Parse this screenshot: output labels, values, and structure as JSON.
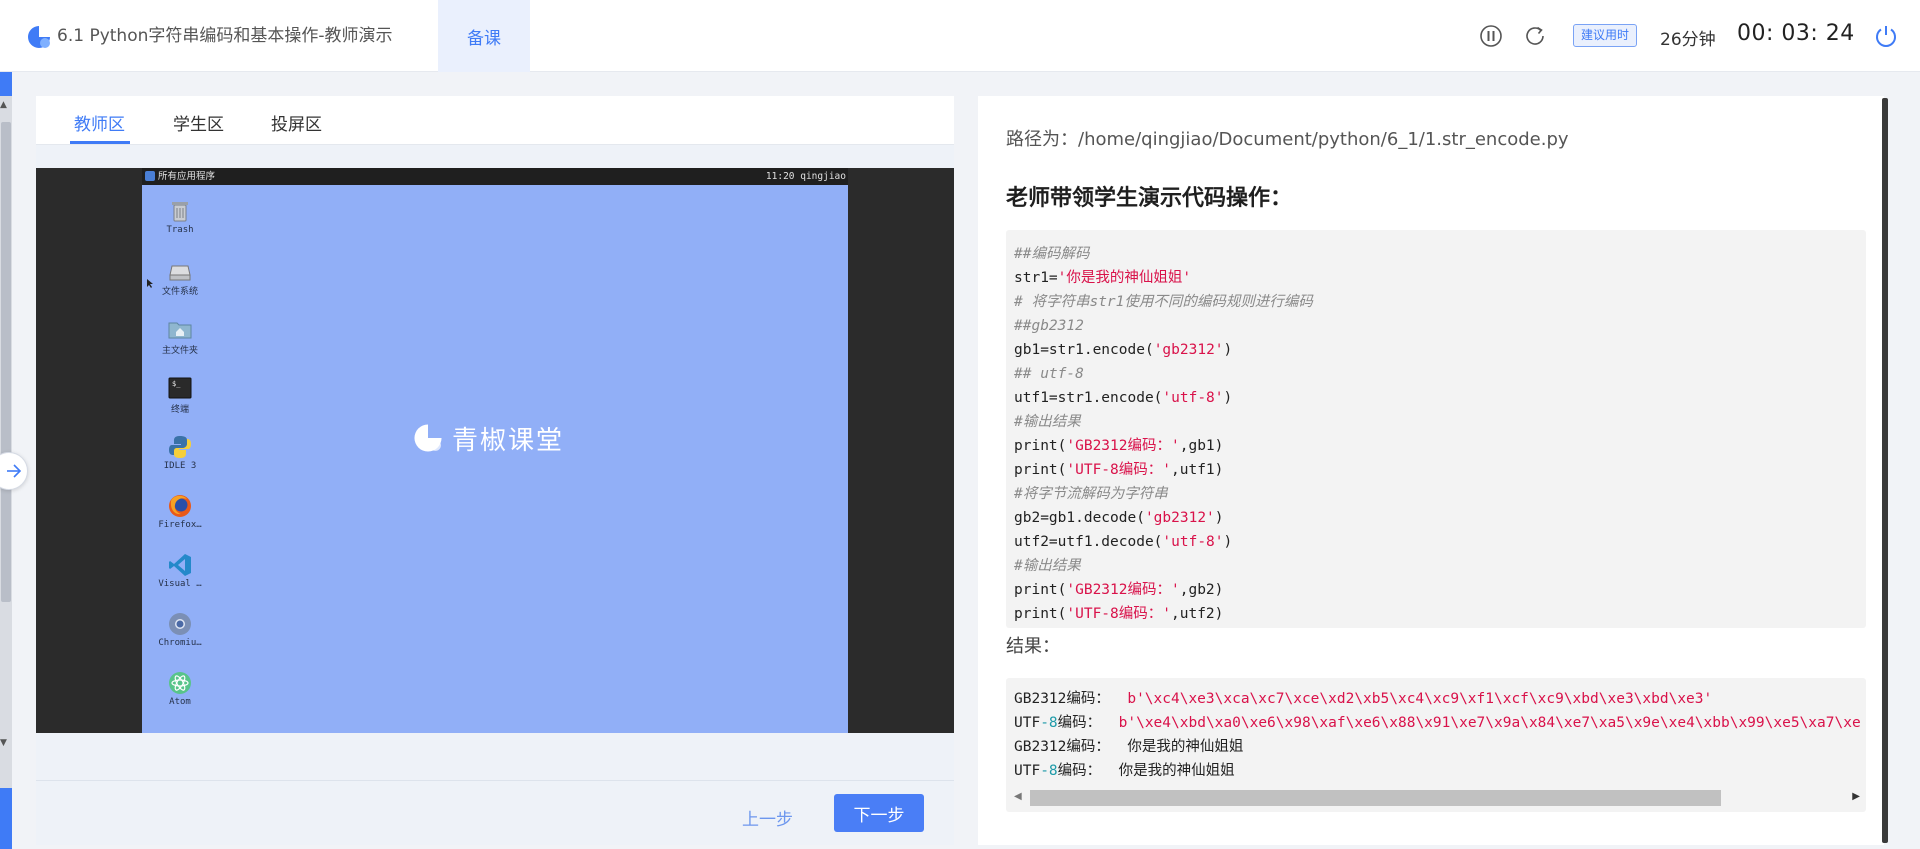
{
  "header": {
    "title": "6.1 Python字符串编码和基本操作-教师演示",
    "tab_label": "备课",
    "suggest_label": "建议用时",
    "duration": "26分钟",
    "timer": "00: 03: 24"
  },
  "left": {
    "tabs": [
      "教师区",
      "学生区",
      "投屏区"
    ],
    "active_tab": 0,
    "vm": {
      "menu_label": "所有应用程序",
      "clock": "11:20 qingjiao",
      "brand": "青椒课堂",
      "icons": [
        {
          "label": "Trash",
          "icon": "trash-icon"
        },
        {
          "label": "文件系统",
          "icon": "drive-icon"
        },
        {
          "label": "主文件夹",
          "icon": "home-folder-icon"
        },
        {
          "label": "终端",
          "icon": "terminal-icon"
        },
        {
          "label": "IDLE 3",
          "icon": "python-icon"
        },
        {
          "label": "Firefox…",
          "icon": "firefox-icon"
        },
        {
          "label": "Visual …",
          "icon": "vscode-icon"
        },
        {
          "label": "Chromiu…",
          "icon": "chromium-icon"
        },
        {
          "label": "Atom",
          "icon": "atom-icon"
        }
      ]
    },
    "prev_label": "上一步",
    "next_label": "下一步"
  },
  "right": {
    "path": "路径为：/home/qingjiao/Document/python/6_1/1.str_encode.py",
    "heading": "老师带领学生演示代码操作：",
    "code_lines": [
      [
        {
          "t": "##编码解码",
          "c": "cm"
        }
      ],
      [
        {
          "t": "str1=",
          "c": ""
        },
        {
          "t": "'你是我的神仙姐姐'",
          "c": "st"
        }
      ],
      [
        {
          "t": "# 将字符串str1使用不同的编码规则进行编码",
          "c": "cm"
        }
      ],
      [
        {
          "t": "##gb2312",
          "c": "cm"
        }
      ],
      [
        {
          "t": "gb1=str1.encode(",
          "c": ""
        },
        {
          "t": "'gb2312'",
          "c": "st"
        },
        {
          "t": ")",
          "c": ""
        }
      ],
      [
        {
          "t": "## utf-8",
          "c": "cm"
        }
      ],
      [
        {
          "t": "utf1=str1.encode(",
          "c": ""
        },
        {
          "t": "'utf-8'",
          "c": "st"
        },
        {
          "t": ")",
          "c": ""
        }
      ],
      [
        {
          "t": "#输出结果",
          "c": "cm"
        }
      ],
      [
        {
          "t": "print(",
          "c": ""
        },
        {
          "t": "'GB2312编码：'",
          "c": "st"
        },
        {
          "t": ",gb1)",
          "c": ""
        }
      ],
      [
        {
          "t": "print(",
          "c": ""
        },
        {
          "t": "'UTF-8编码：'",
          "c": "st"
        },
        {
          "t": ",utf1)",
          "c": ""
        }
      ],
      [
        {
          "t": "#将字节流解码为字符串",
          "c": "cm"
        }
      ],
      [
        {
          "t": "gb2=gb1.decode(",
          "c": ""
        },
        {
          "t": "'gb2312'",
          "c": "st"
        },
        {
          "t": ")",
          "c": ""
        }
      ],
      [
        {
          "t": "utf2=utf1.decode(",
          "c": ""
        },
        {
          "t": "'utf-8'",
          "c": "st"
        },
        {
          "t": ")",
          "c": ""
        }
      ],
      [
        {
          "t": "#输出结果",
          "c": "cm"
        }
      ],
      [
        {
          "t": "print(",
          "c": ""
        },
        {
          "t": "'GB2312编码：'",
          "c": "st"
        },
        {
          "t": ",gb2)",
          "c": ""
        }
      ],
      [
        {
          "t": "print(",
          "c": ""
        },
        {
          "t": "'UTF-8编码：'",
          "c": "st"
        },
        {
          "t": ",utf2)",
          "c": ""
        }
      ]
    ],
    "result_label": "结果：",
    "result_lines": [
      [
        {
          "t": "GB2312编码：  ",
          "c": "rs-key"
        },
        {
          "t": "b'\\xc4\\xe3\\xca\\xc7\\xce\\xd2\\xb5\\xc4\\xc9\\xf1\\xcf\\xc9\\xbd\\xe3\\xbd\\xe3'",
          "c": "rs-val"
        }
      ],
      [
        {
          "t": "UTF",
          "c": "rs-key"
        },
        {
          "t": "-8",
          "c": "rs-blue"
        },
        {
          "t": "编码：  ",
          "c": "rs-key"
        },
        {
          "t": "b'\\xe4\\xbd\\xa0\\xe6\\x98\\xaf\\xe6\\x88\\x91\\xe7\\x9a\\x84\\xe7\\xa5\\x9e\\xe4\\xbb\\x99\\xe5\\xa7\\xe",
          "c": "rs-val"
        }
      ],
      [
        {
          "t": "GB2312编码：  你是我的神仙姐姐",
          "c": "rs-key"
        }
      ],
      [
        {
          "t": "UTF",
          "c": "rs-key"
        },
        {
          "t": "-8",
          "c": "rs-blue"
        },
        {
          "t": "编码：  你是我的神仙姐姐",
          "c": "rs-key"
        }
      ]
    ]
  },
  "colors": {
    "accent": "#3f7bf6",
    "desktop": "#91aff7",
    "string": "#d9124a",
    "comment": "#8a8a8a"
  }
}
